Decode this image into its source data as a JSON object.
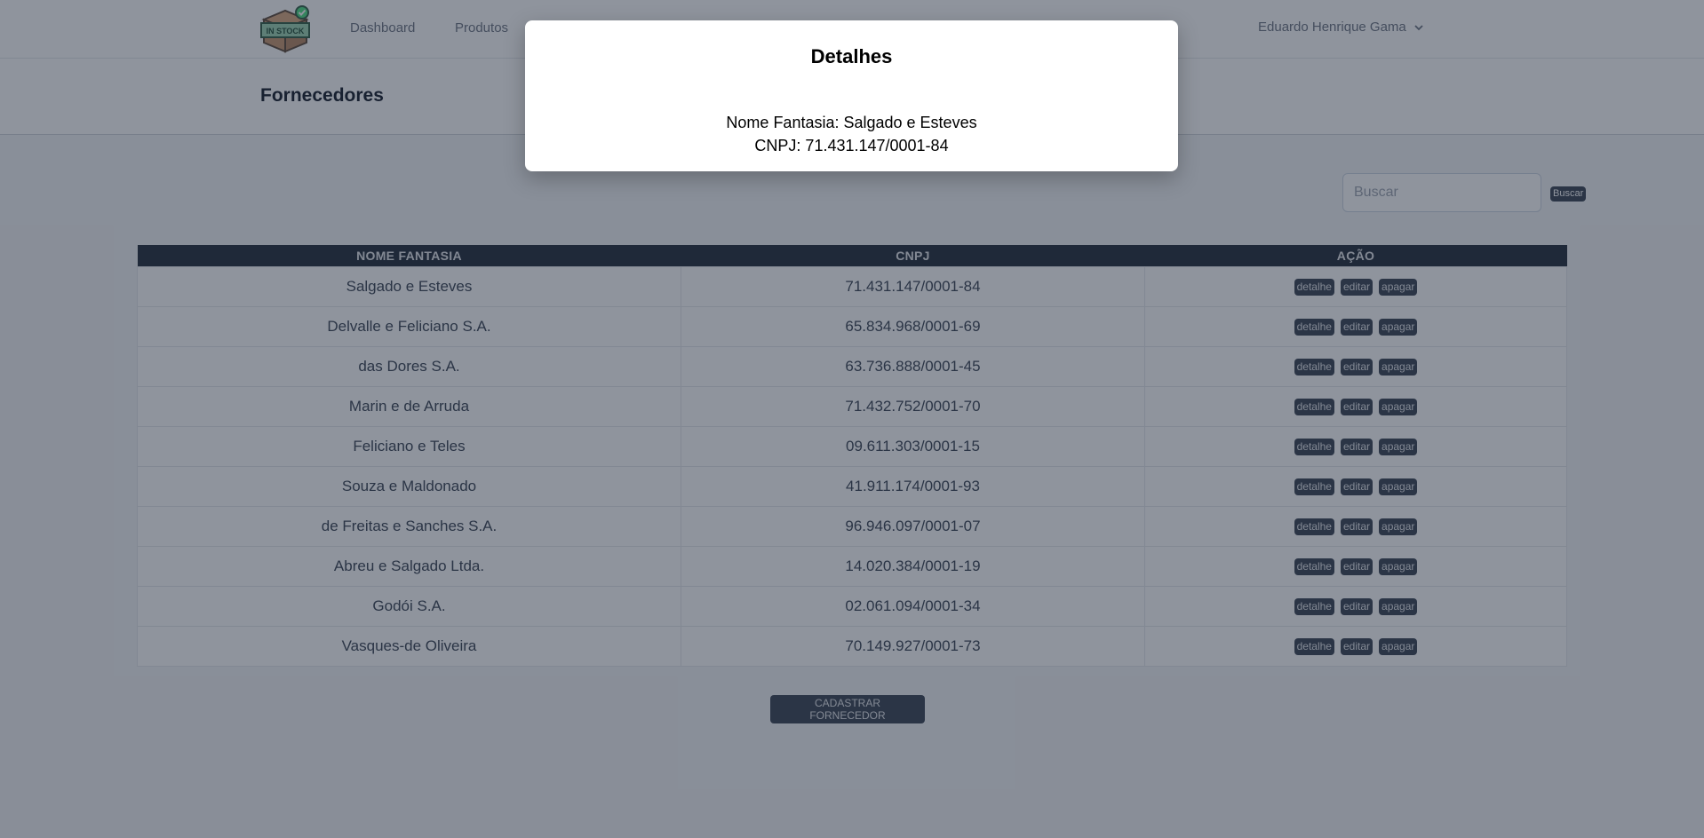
{
  "nav": {
    "logo_text": "IN STOCK",
    "links": [
      "Dashboard",
      "Produtos"
    ],
    "user_name": "Eduardo Henrique Gama"
  },
  "page": {
    "title": "Fornecedores"
  },
  "search": {
    "placeholder": "Buscar",
    "button_label": "Buscar"
  },
  "table": {
    "headers": [
      "NOME FANTASIA",
      "CNPJ",
      "AÇÃO"
    ],
    "action_labels": {
      "detail": "detalhe",
      "edit": "editar",
      "delete": "apagar"
    },
    "rows": [
      {
        "name": "Salgado e Esteves",
        "cnpj": "71.431.147/0001-84"
      },
      {
        "name": "Delvalle e Feliciano S.A.",
        "cnpj": "65.834.968/0001-69"
      },
      {
        "name": "das Dores S.A.",
        "cnpj": "63.736.888/0001-45"
      },
      {
        "name": "Marin e de Arruda",
        "cnpj": "71.432.752/0001-70"
      },
      {
        "name": "Feliciano e Teles",
        "cnpj": "09.611.303/0001-15"
      },
      {
        "name": "Souza e Maldonado",
        "cnpj": "41.911.174/0001-93"
      },
      {
        "name": "de Freitas e Sanches S.A.",
        "cnpj": "96.946.097/0001-07"
      },
      {
        "name": "Abreu e Salgado Ltda.",
        "cnpj": "14.020.384/0001-19"
      },
      {
        "name": "Godói S.A.",
        "cnpj": "02.061.094/0001-34"
      },
      {
        "name": "Vasques-de Oliveira",
        "cnpj": "70.149.927/0001-73"
      }
    ]
  },
  "create_button_label": "CADASTRAR FORNECEDOR",
  "modal": {
    "title": "Detalhes",
    "line1": "Nome Fantasia: Salgado e Esteves",
    "line2": "CNPJ: 71.431.147/0001-84"
  },
  "colors": {
    "header_bg": "#1f2937",
    "button_bg": "#374151",
    "overlay": "rgba(31,41,59,0.5)",
    "logo_green": "#4ade80",
    "logo_box": "#c7956d"
  }
}
